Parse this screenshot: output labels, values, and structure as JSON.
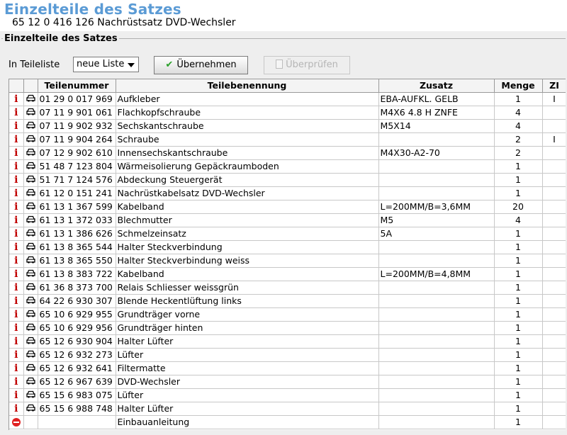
{
  "header": {
    "title": "Einzelteile des Satzes",
    "subtitle": "65 12 0 416 126 Nachrüstsatz DVD-Wechsler"
  },
  "group": {
    "title": "Einzelteile des Satzes"
  },
  "controls": {
    "teileliste_label": "In Teileliste",
    "dropdown_value": "neue Liste",
    "ok_button": "Übernehmen",
    "check_button": "Überprüfen"
  },
  "table": {
    "columns": [
      "",
      "",
      "Teilenummer",
      "Teilebenennung",
      "Zusatz",
      "Menge",
      "ZI"
    ],
    "rows": [
      {
        "icon": "info-icon",
        "nr": "01 29 0 017 969",
        "name": "Aufkleber",
        "zusatz": "EBA-AUFKL. GELB",
        "menge": "1",
        "zi": "I"
      },
      {
        "icon": "info-icon",
        "nr": "07 11 9 901 061",
        "name": "Flachkopfschraube",
        "zusatz": "M4X6 4.8 H ZNFE",
        "menge": "4",
        "zi": ""
      },
      {
        "icon": "info-icon",
        "nr": "07 11 9 902 932",
        "name": "Sechskantschraube",
        "zusatz": "M5X14",
        "menge": "4",
        "zi": ""
      },
      {
        "icon": "info-icon",
        "nr": "07 11 9 904 264",
        "name": "Schraube",
        "zusatz": "",
        "menge": "2",
        "zi": "I"
      },
      {
        "icon": "info-icon",
        "nr": "07 12 9 902 610",
        "name": "Innensechskantschraube",
        "zusatz": "M4X30-A2-70",
        "menge": "2",
        "zi": ""
      },
      {
        "icon": "info-icon",
        "nr": "51 48 7 123 804",
        "name": "Wärmeisolierung Gepäckraumboden",
        "zusatz": "",
        "menge": "1",
        "zi": ""
      },
      {
        "icon": "info-icon",
        "nr": "51 71 7 124 576",
        "name": "Abdeckung Steuergerät",
        "zusatz": "",
        "menge": "1",
        "zi": ""
      },
      {
        "icon": "info-icon",
        "nr": "61 12 0 151 241",
        "name": "Nachrüstkabelsatz DVD-Wechsler",
        "zusatz": "",
        "menge": "1",
        "zi": ""
      },
      {
        "icon": "info-icon",
        "nr": "61 13 1 367 599",
        "name": "Kabelband",
        "zusatz": "L=200MM/B=3,6MM",
        "menge": "20",
        "zi": ""
      },
      {
        "icon": "info-icon",
        "nr": "61 13 1 372 033",
        "name": "Blechmutter",
        "zusatz": "M5",
        "menge": "4",
        "zi": ""
      },
      {
        "icon": "info-icon",
        "nr": "61 13 1 386 626",
        "name": "Schmelzeinsatz",
        "zusatz": "5A",
        "menge": "1",
        "zi": ""
      },
      {
        "icon": "info-icon",
        "nr": "61 13 8 365 544",
        "name": "Halter Steckverbindung",
        "zusatz": "",
        "menge": "1",
        "zi": ""
      },
      {
        "icon": "info-icon",
        "nr": "61 13 8 365 550",
        "name": "Halter Steckverbindung weiss",
        "zusatz": "",
        "menge": "1",
        "zi": ""
      },
      {
        "icon": "info-icon",
        "nr": "61 13 8 383 722",
        "name": "Kabelband",
        "zusatz": "L=200MM/B=4,8MM",
        "menge": "1",
        "zi": ""
      },
      {
        "icon": "info-icon",
        "nr": "61 36 8 373 700",
        "name": "Relais Schliesser weissgrün",
        "zusatz": "",
        "menge": "1",
        "zi": ""
      },
      {
        "icon": "info-icon",
        "nr": "64 22 6 930 307",
        "name": "Blende Heckentlüftung links",
        "zusatz": "",
        "menge": "1",
        "zi": ""
      },
      {
        "icon": "info-icon",
        "nr": "65 10 6 929 955",
        "name": "Grundträger vorne",
        "zusatz": "",
        "menge": "1",
        "zi": ""
      },
      {
        "icon": "info-icon",
        "nr": "65 10 6 929 956",
        "name": "Grundträger hinten",
        "zusatz": "",
        "menge": "1",
        "zi": ""
      },
      {
        "icon": "info-icon",
        "nr": "65 12 6 930 904",
        "name": "Halter Lüfter",
        "zusatz": "",
        "menge": "1",
        "zi": ""
      },
      {
        "icon": "info-icon",
        "nr": "65 12 6 932 273",
        "name": "Lüfter",
        "zusatz": "",
        "menge": "1",
        "zi": ""
      },
      {
        "icon": "info-icon",
        "nr": "65 12 6 932 641",
        "name": "Filtermatte",
        "zusatz": "",
        "menge": "1",
        "zi": ""
      },
      {
        "icon": "info-icon",
        "nr": "65 12 6 967 639",
        "name": "DVD-Wechsler",
        "zusatz": "",
        "menge": "1",
        "zi": ""
      },
      {
        "icon": "info-icon",
        "nr": "65 15 6 983 075",
        "name": "Lüfter",
        "zusatz": "",
        "menge": "1",
        "zi": ""
      },
      {
        "icon": "info-icon",
        "nr": "65 15 6 988 748",
        "name": "Halter Lüfter",
        "zusatz": "",
        "menge": "1",
        "zi": ""
      },
      {
        "icon": "no-entry-icon",
        "nr": "",
        "name": "Einbauanleitung",
        "zusatz": "",
        "menge": "1",
        "zi": ""
      }
    ]
  },
  "colors": {
    "title": "#5b9bd5",
    "info_icon": "#c00000",
    "check": "#2aa02a",
    "no_entry": "#e02020"
  }
}
